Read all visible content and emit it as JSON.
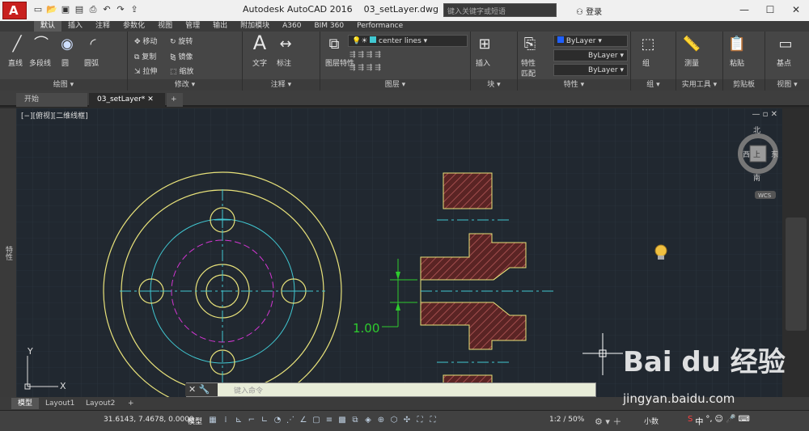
{
  "app": {
    "title": "Autodesk AutoCAD 2016",
    "filename": "03_setLayer.dwg",
    "search_placeholder": "键入关键字或短语",
    "login_label": "登录",
    "app_button_label": "A"
  },
  "ribbon_tabs": [
    "默认",
    "插入",
    "注释",
    "参数化",
    "视图",
    "管理",
    "输出",
    "附加模块",
    "A360",
    "BIM 360",
    "Performance"
  ],
  "ribbon": {
    "draw": {
      "title": "绘图 ▾",
      "line": "直线",
      "polyline": "多段线",
      "circle": "圆",
      "arc": "圆弧"
    },
    "modify": {
      "title": "修改 ▾",
      "move": "移动",
      "rotate": "旋转",
      "copy": "复制",
      "mirror": "镜像",
      "stretch": "拉伸",
      "scale": "缩放"
    },
    "annotation": {
      "title": "注释 ▾",
      "text": "文字",
      "dim": "标注"
    },
    "layers": {
      "title": "图层 ▾",
      "props": "图层特性",
      "current_layer": "center lines"
    },
    "block": {
      "title": "块 ▾",
      "insert": "插入"
    },
    "properties": {
      "title": "特性 ▾",
      "match": "特性匹配",
      "color": "ByLayer",
      "linetype": "ByLayer",
      "lineweight": "ByLayer"
    },
    "groups": {
      "title": "组 ▾",
      "group": "组"
    },
    "utilities": {
      "title": "实用工具 ▾",
      "measure": "测量"
    },
    "clipboard": {
      "title": "剪贴板",
      "paste": "粘贴"
    },
    "view": {
      "title": "视图 ▾",
      "base": "基点"
    }
  },
  "doc_tabs": {
    "start": "开始",
    "active": "03_setLayer*",
    "add": "+"
  },
  "viewport": {
    "label": "[−][俯视][二维线框]",
    "ctl": "— ▫ ✕"
  },
  "viewcube": {
    "n": "北",
    "s": "南",
    "e": "东",
    "w": "西",
    "top": "上",
    "wcs": "WCS"
  },
  "drawing": {
    "dimension": "1.00",
    "ucs_x": "X",
    "ucs_y": "Y"
  },
  "left_palette": "特性",
  "cmdline": {
    "placeholder": "键入命令"
  },
  "layout_tabs": [
    "模型",
    "Layout1",
    "Layout2",
    "+"
  ],
  "status": {
    "coords": "31.6143, 7.4678, 0.0000",
    "model": "模型",
    "scale": "1:2 / 50%",
    "units": "小数"
  },
  "watermark": {
    "main": "Bai du 经验",
    "sub": "jingyan.baidu.com"
  },
  "colors": {
    "accent_red": "#c8201e",
    "center_cyan": "#41c8d2",
    "outline_yellow": "#e8e27a",
    "hidden_magenta": "#d236d2",
    "dim_green": "#2ecc2e",
    "hatch": "#b85a5a"
  }
}
